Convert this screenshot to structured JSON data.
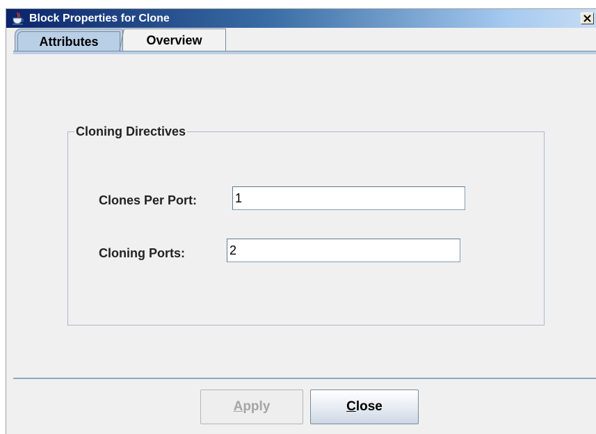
{
  "window": {
    "title": "Block Properties for Clone",
    "icon": "java-coffee-cup-icon",
    "close_icon": "close-icon"
  },
  "tabs": [
    {
      "label": "Attributes",
      "selected": true
    },
    {
      "label": "Overview",
      "selected": false
    }
  ],
  "group": {
    "title": "Cloning Directives",
    "fields": [
      {
        "label": "Clones Per Port:",
        "value": "1"
      },
      {
        "label": "Cloning Ports:",
        "value": "2"
      }
    ]
  },
  "buttons": {
    "apply": {
      "mnemonic": "A",
      "rest": "pply",
      "enabled": false
    },
    "close": {
      "mnemonic": "C",
      "rest": "lose",
      "enabled": true
    }
  },
  "colors": {
    "title_gradient_start": "#0a246a",
    "title_gradient_end": "#c6dcf4",
    "selected_tab": "#b9cfe6",
    "disabled_text": "#a5a5a5"
  }
}
